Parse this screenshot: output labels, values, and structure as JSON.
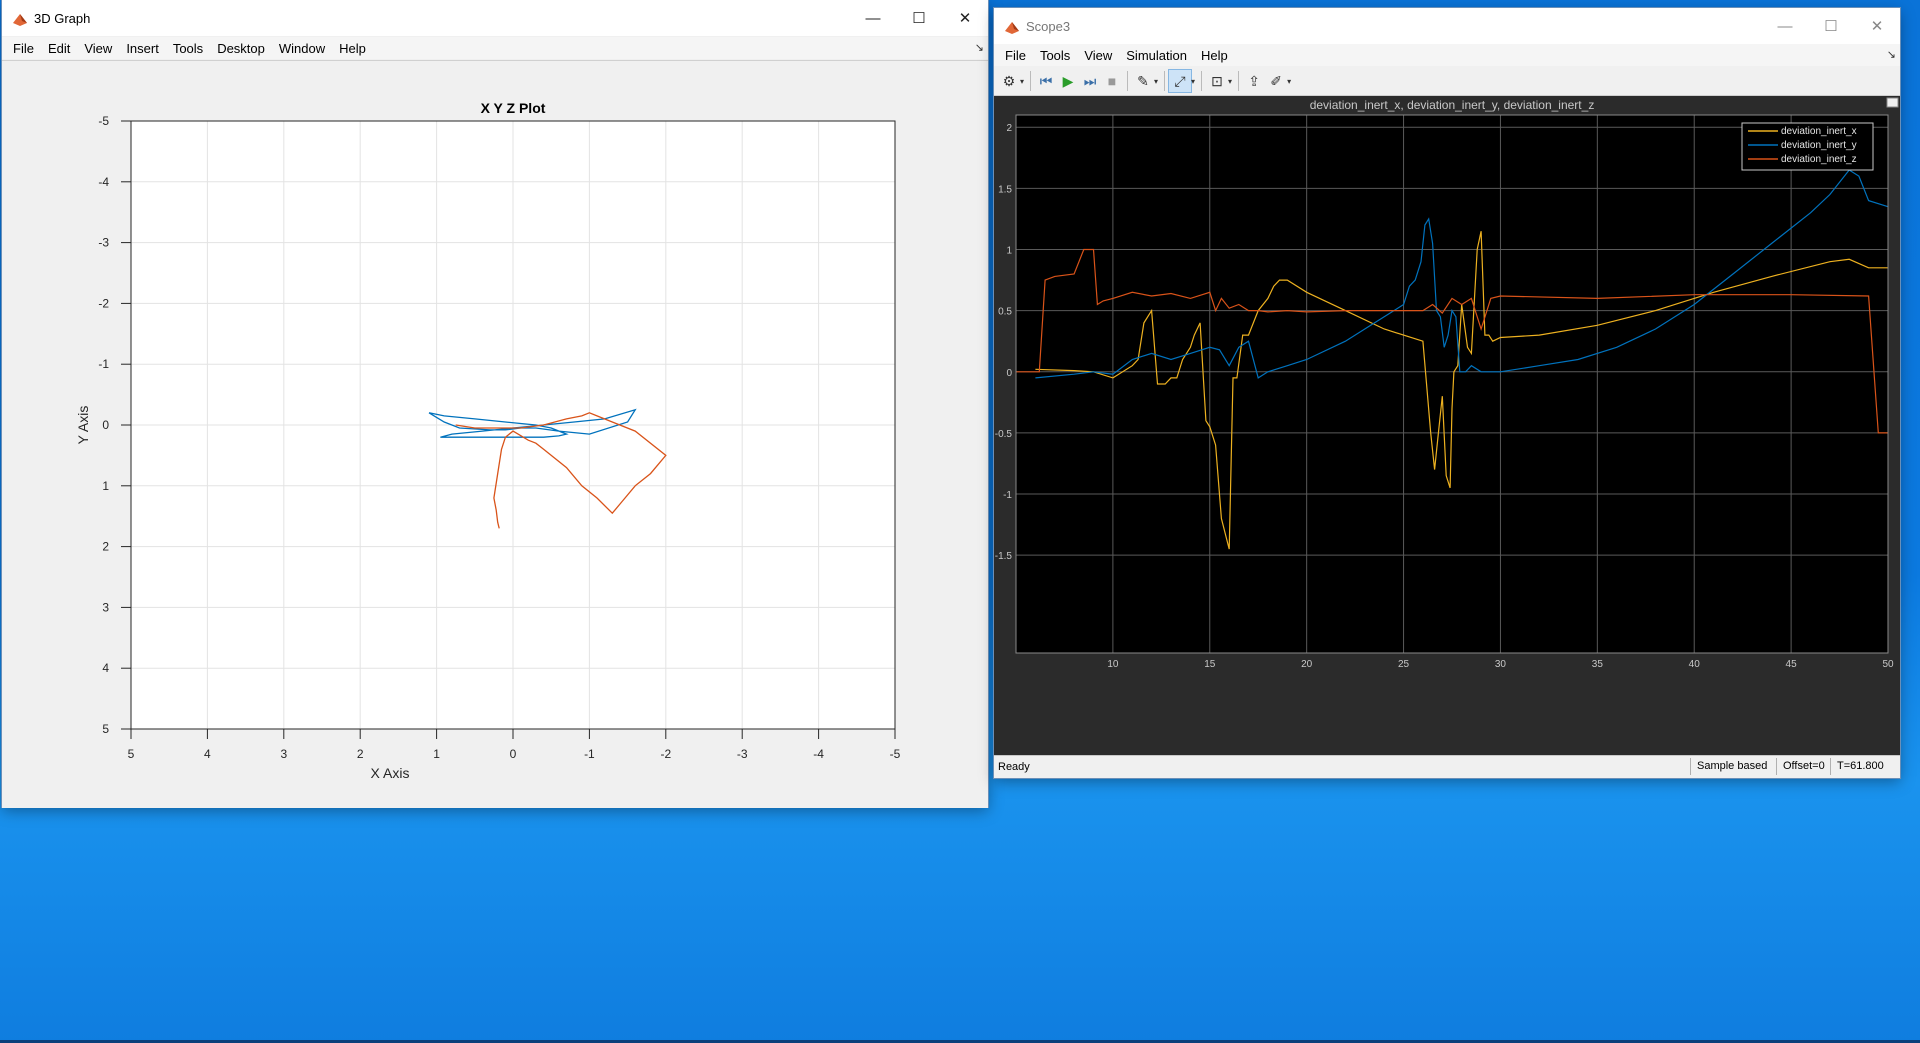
{
  "window1": {
    "title": "3D Graph",
    "menu": [
      "File",
      "Edit",
      "View",
      "Insert",
      "Tools",
      "Desktop",
      "Window",
      "Help"
    ],
    "controls": {
      "minimize": "—",
      "maximize": "☐",
      "close": "✕"
    }
  },
  "window2": {
    "title": "Scope3",
    "menu": [
      "File",
      "Tools",
      "View",
      "Simulation",
      "Help"
    ],
    "controls": {
      "minimize": "—",
      "maximize": "☐",
      "close": "✕"
    },
    "status": {
      "ready": "Ready",
      "mode": "Sample based",
      "offset": "Offset=0",
      "time": "T=61.800"
    }
  },
  "chart_data": [
    {
      "type": "line",
      "title": "X Y Z Plot",
      "xlabel": "X Axis",
      "ylabel": "Y Axis",
      "xlim": [
        5,
        -5
      ],
      "ylim": [
        -5,
        5
      ],
      "xticks": [
        "5",
        "4",
        "3",
        "2",
        "1",
        "0",
        "-1",
        "-2",
        "-3",
        "-4",
        "-5"
      ],
      "yticks": [
        "-5",
        "-4",
        "-3",
        "-2",
        "-1",
        "0",
        "1",
        "2",
        "3",
        "4",
        "5"
      ],
      "grid": true,
      "colors": {
        "blue": "#0072bd",
        "orange": "#d95319"
      },
      "series": [
        {
          "color": "#0072bd",
          "x": [
            1.1,
            0.9,
            0.7,
            0.3,
            0.1,
            -0.1,
            -0.3,
            -0.6,
            -1.0,
            -1.5,
            -1.6,
            -1.2,
            -0.8,
            -0.4,
            0.0,
            0.4,
            0.8,
            0.95,
            0.7,
            0.3,
            0.0,
            -0.2,
            -0.4,
            -0.6,
            -0.7,
            -0.5,
            -0.3,
            0.1,
            0.5,
            0.9,
            1.1
          ],
          "y": [
            -0.2,
            -0.05,
            0.05,
            0.08,
            0.08,
            0.05,
            0.05,
            0.1,
            0.15,
            -0.05,
            -0.25,
            -0.1,
            -0.05,
            0.0,
            0.05,
            0.1,
            0.15,
            0.2,
            0.2,
            0.2,
            0.2,
            0.2,
            0.2,
            0.18,
            0.15,
            0.05,
            0.0,
            -0.05,
            -0.1,
            -0.15,
            -0.2
          ]
        },
        {
          "color": "#d95319",
          "x": [
            0.75,
            0.5,
            0.2,
            -0.1,
            -0.4,
            -0.7,
            -0.9,
            -1.0,
            -1.1,
            -1.3,
            -1.6,
            -2.0,
            -1.8,
            -1.6,
            -1.4,
            -1.3,
            -1.1,
            -0.9,
            -0.7,
            -0.4,
            -0.3,
            -0.2,
            0.0,
            0.1,
            0.15,
            0.2,
            0.25,
            0.22,
            0.2,
            0.18
          ],
          "y": [
            0.0,
            0.05,
            0.05,
            0.05,
            0.0,
            -0.1,
            -0.15,
            -0.2,
            -0.15,
            -0.05,
            0.1,
            0.5,
            0.8,
            1.0,
            1.3,
            1.45,
            1.2,
            1.0,
            0.7,
            0.4,
            0.3,
            0.25,
            0.1,
            0.2,
            0.4,
            0.8,
            1.2,
            1.4,
            1.6,
            1.7
          ]
        }
      ]
    },
    {
      "type": "line",
      "title": "deviation_inert_x, deviation_inert_y, deviation_inert_z",
      "xlim": [
        5,
        50
      ],
      "ylim": [
        -2.3,
        2.1
      ],
      "xticks": [
        "10",
        "15",
        "20",
        "25",
        "30",
        "35",
        "40",
        "45",
        "50"
      ],
      "yticks": [
        "2",
        "1.5",
        "1",
        "0.5",
        "0",
        "-0.5",
        "-1",
        "-1.5"
      ],
      "grid": true,
      "legend_position": "top-right",
      "colors": {
        "background": "#000000",
        "grid": "#5a5a5a",
        "axes_bg": "#2b2b2b"
      },
      "series": [
        {
          "name": "deviation_inert_x",
          "color": "#edb120",
          "x": [
            6,
            8,
            9,
            10,
            11,
            11.3,
            11.6,
            12,
            12.3,
            12.7,
            13,
            13.3,
            13.6,
            14,
            14.2,
            14.5,
            14.8,
            15,
            15.3,
            15.6,
            16,
            16.2,
            16.4,
            16.7,
            17,
            17.5,
            18,
            18.3,
            18.6,
            19,
            20,
            22,
            24,
            26,
            26.4,
            26.6,
            26.8,
            27,
            27.2,
            27.4,
            27.5,
            27.6,
            27.8,
            28,
            28.3,
            28.5,
            28.8,
            29,
            29.2,
            29.4,
            29.6,
            30,
            32,
            35,
            38,
            41,
            44,
            47,
            48,
            49,
            50
          ],
          "y": [
            0.02,
            0.01,
            0.0,
            -0.05,
            0.05,
            0.1,
            0.4,
            0.5,
            -0.1,
            -0.1,
            -0.05,
            -0.05,
            0.1,
            0.2,
            0.3,
            0.4,
            -0.4,
            -0.45,
            -0.6,
            -1.2,
            -1.45,
            -0.05,
            -0.05,
            0.3,
            0.3,
            0.5,
            0.6,
            0.7,
            0.75,
            0.75,
            0.65,
            0.5,
            0.35,
            0.25,
            -0.5,
            -0.8,
            -0.5,
            -0.2,
            -0.85,
            -0.95,
            -0.3,
            0.0,
            0.05,
            0.55,
            0.2,
            0.15,
            1.0,
            1.15,
            0.3,
            0.3,
            0.25,
            0.28,
            0.3,
            0.38,
            0.5,
            0.65,
            0.78,
            0.9,
            0.92,
            0.85,
            0.85
          ]
        },
        {
          "name": "deviation_inert_y",
          "color": "#0072bd",
          "x": [
            6,
            8,
            9,
            10,
            11,
            12,
            13,
            14,
            15,
            15.5,
            16,
            16.5,
            17,
            17.5,
            18,
            19,
            20,
            22,
            24,
            25,
            25.3,
            25.6,
            25.9,
            26.1,
            26.3,
            26.5,
            26.7,
            26.9,
            27.1,
            27.3,
            27.5,
            27.7,
            27.9,
            28.2,
            28.5,
            29,
            29.5,
            30,
            32,
            34,
            36,
            38,
            40,
            42,
            44,
            46,
            47,
            48,
            48.5,
            49,
            50
          ],
          "y": [
            -0.05,
            -0.02,
            0.0,
            -0.02,
            0.1,
            0.15,
            0.1,
            0.15,
            0.2,
            0.18,
            0.05,
            0.2,
            0.25,
            -0.05,
            0.0,
            0.05,
            0.1,
            0.25,
            0.45,
            0.55,
            0.7,
            0.75,
            0.9,
            1.2,
            1.25,
            1.05,
            0.5,
            0.45,
            0.2,
            0.3,
            0.5,
            0.45,
            0.0,
            0.0,
            0.05,
            0.0,
            0.0,
            0.0,
            0.05,
            0.1,
            0.2,
            0.35,
            0.55,
            0.8,
            1.05,
            1.3,
            1.45,
            1.65,
            1.6,
            1.4,
            1.35
          ]
        },
        {
          "name": "deviation_inert_z",
          "color": "#d95319",
          "x": [
            5,
            6.2,
            6.5,
            7,
            8,
            8.5,
            9,
            9.2,
            9.5,
            10,
            11,
            12,
            13,
            14,
            15,
            15.3,
            15.6,
            16,
            16.5,
            17,
            17.5,
            18,
            19,
            20,
            22,
            24,
            25,
            25.5,
            26,
            26.5,
            27,
            27.5,
            28,
            28.5,
            29,
            29.5,
            30,
            35,
            40,
            45,
            49,
            49.5,
            50
          ],
          "y": [
            0.0,
            0.0,
            0.75,
            0.78,
            0.8,
            1.0,
            1.0,
            0.55,
            0.58,
            0.6,
            0.65,
            0.62,
            0.64,
            0.6,
            0.65,
            0.5,
            0.6,
            0.52,
            0.55,
            0.5,
            0.5,
            0.49,
            0.5,
            0.49,
            0.5,
            0.5,
            0.5,
            0.5,
            0.5,
            0.55,
            0.48,
            0.6,
            0.55,
            0.6,
            0.35,
            0.6,
            0.62,
            0.6,
            0.63,
            0.63,
            0.62,
            -0.5,
            -0.5
          ]
        }
      ]
    }
  ]
}
